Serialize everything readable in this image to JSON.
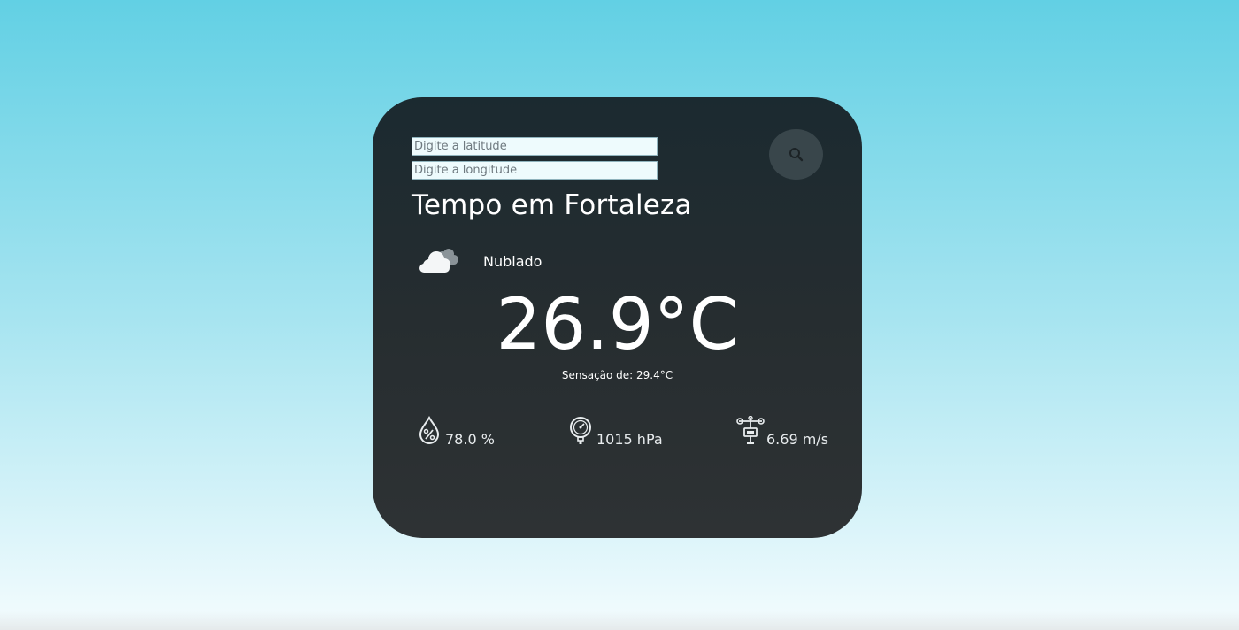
{
  "search": {
    "latitude_placeholder": "Digite a latitude",
    "longitude_placeholder": "Digite a longitude",
    "button_icon": "search-icon"
  },
  "weather": {
    "title": "Tempo em Fortaleza",
    "condition_icon": "cloud-icon",
    "condition": "Nublado",
    "temperature": "26.9°C",
    "feels_like": "Sensação de: 29.4°C",
    "humidity": "78.0 %",
    "pressure": "1015 hPa",
    "wind": "6.69 m/s"
  },
  "colors": {
    "card_top": "#1b2a30",
    "card_bottom": "#2e3234",
    "background_top": "#62d0e4",
    "background_bottom": "#f4fcfe",
    "search_button": "#39464b"
  }
}
